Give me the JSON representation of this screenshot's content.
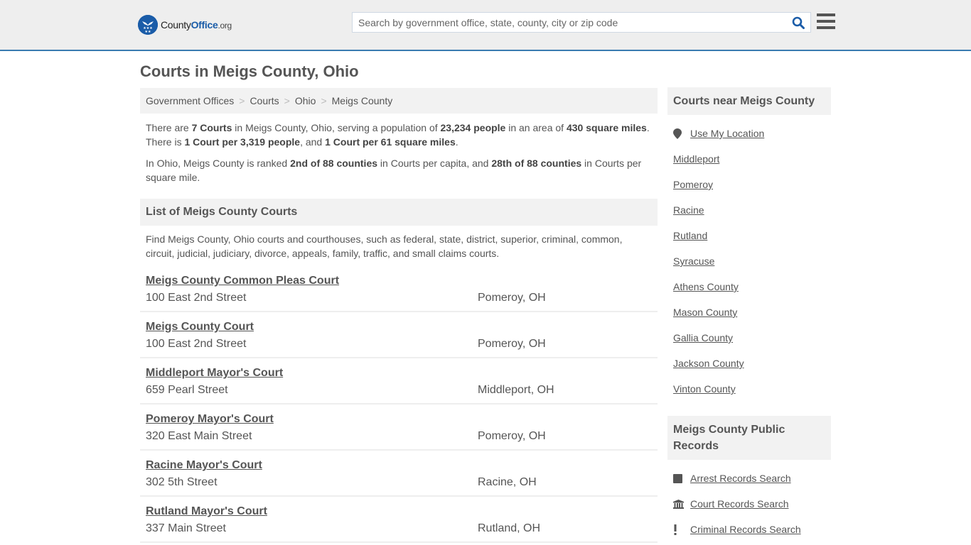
{
  "header": {
    "logo": {
      "county": "County",
      "office": "Office",
      "org": ".org"
    },
    "search": {
      "placeholder": "Search by government office, state, county, city or zip code",
      "value": ""
    },
    "colors": {
      "accent": "#3a7cb0",
      "brand": "#1a5ca8"
    }
  },
  "page": {
    "title": "Courts in Meigs County, Ohio",
    "breadcrumb": [
      "Government Offices",
      "Courts",
      "Ohio",
      "Meigs County"
    ],
    "intro": {
      "p1": {
        "t1": "There are ",
        "b1": "7 Courts",
        "t2": " in Meigs County, Ohio, serving a population of ",
        "b2": "23,234 people",
        "t3": " in an area of ",
        "b3": "430 square miles",
        "t4": ". There is ",
        "b4": "1 Court per 3,319 people",
        "t5": ", and ",
        "b5": "1 Court per 61 square miles",
        "t6": "."
      },
      "p2": {
        "t1": "In Ohio, Meigs County is ranked ",
        "b1": "2nd of 88 counties",
        "t2": " in Courts per capita, and ",
        "b2": "28th of 88 counties",
        "t3": " in Courts per square mile."
      }
    },
    "list_section": {
      "title": "List of Meigs County Courts",
      "description": "Find Meigs County, Ohio courts and courthouses, such as federal, state, district, superior, criminal, common, circuit, judicial, judiciary, divorce, appeals, family, traffic, and small claims courts."
    },
    "courts": [
      {
        "name": "Meigs County Common Pleas Court",
        "address": "100 East 2nd Street",
        "city": "Pomeroy, OH"
      },
      {
        "name": "Meigs County Court",
        "address": "100 East 2nd Street",
        "city": "Pomeroy, OH"
      },
      {
        "name": "Middleport Mayor's Court",
        "address": "659 Pearl Street",
        "city": "Middleport, OH"
      },
      {
        "name": "Pomeroy Mayor's Court",
        "address": "320 East Main Street",
        "city": "Pomeroy, OH"
      },
      {
        "name": "Racine Mayor's Court",
        "address": "302 5th Street",
        "city": "Racine, OH"
      },
      {
        "name": "Rutland Mayor's Court",
        "address": "337 Main Street",
        "city": "Rutland, OH"
      }
    ]
  },
  "sidebar": {
    "nearby": {
      "title": "Courts near Meigs County",
      "use_location": {
        "label": "Use My Location",
        "icon": "map-marker-icon"
      },
      "links": [
        "Middleport",
        "Pomeroy",
        "Racine",
        "Rutland",
        "Syracuse",
        "Athens County",
        "Mason County",
        "Gallia County",
        "Jackson County",
        "Vinton County"
      ]
    },
    "records": {
      "title": "Meigs County Public Records",
      "links": [
        {
          "label": "Arrest Records Search",
          "icon": "square-icon"
        },
        {
          "label": "Court Records Search",
          "icon": "courthouse-icon"
        },
        {
          "label": "Criminal Records Search",
          "icon": "exclamation-icon"
        }
      ]
    }
  }
}
